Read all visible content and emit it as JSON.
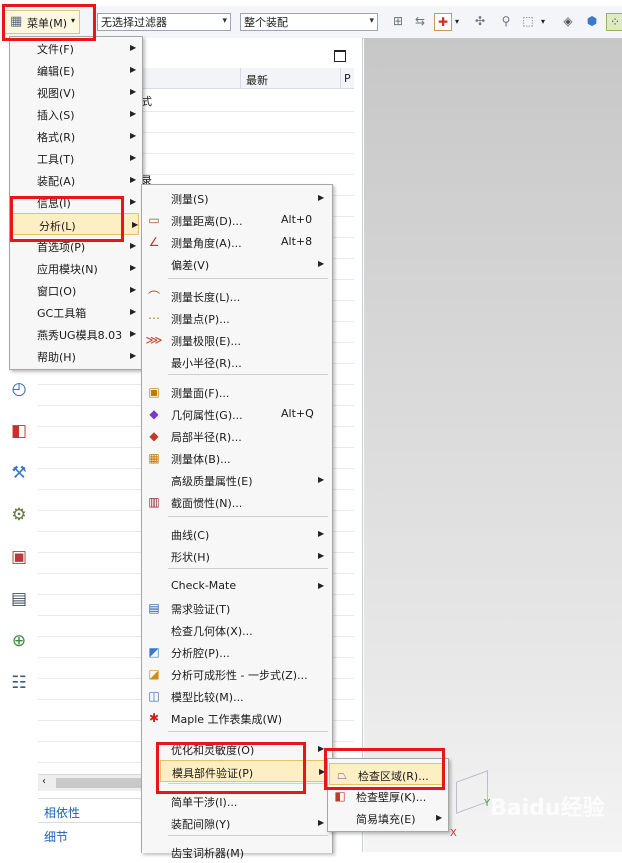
{
  "toolbar": {
    "menu_label": "菜单(M)",
    "filter_value": "无选择过滤器",
    "assembly_value": "整个装配"
  },
  "nav": {
    "col_latest": "最新",
    "col_p": "P",
    "frag1": "式",
    "frag2": "录",
    "footer1": "相依性",
    "footer2": "细节"
  },
  "main_menu": [
    {
      "label": "文件(F)",
      "arrow": true
    },
    {
      "label": "编辑(E)",
      "arrow": true
    },
    {
      "label": "视图(V)",
      "arrow": true
    },
    {
      "label": "插入(S)",
      "arrow": true
    },
    {
      "label": "格式(R)",
      "arrow": true
    },
    {
      "label": "工具(T)",
      "arrow": true
    },
    {
      "label": "装配(A)",
      "arrow": true
    },
    {
      "label": "信息(I)",
      "arrow": true
    },
    {
      "label": "分析(L)",
      "arrow": true
    },
    {
      "label": "首选项(P)",
      "arrow": true
    },
    {
      "label": "应用模块(N)",
      "arrow": true
    },
    {
      "label": "窗口(O)",
      "arrow": true
    },
    {
      "label": "GC工具箱",
      "arrow": true
    },
    {
      "label": "燕秀UG模具8.03",
      "arrow": true
    },
    {
      "label": "帮助(H)",
      "arrow": true
    }
  ],
  "analysis_menu": [
    {
      "label": "测量(S)",
      "arrow": true,
      "icon": "none"
    },
    {
      "label": "测量距离(D)...",
      "shortcut": "Alt+0",
      "icon": "ruler-icon"
    },
    {
      "label": "测量角度(A)...",
      "shortcut": "Alt+8",
      "icon": "angle-icon"
    },
    {
      "label": "偏差(V)",
      "arrow": true,
      "icon": "none"
    },
    {
      "label": "测量长度(L)...",
      "icon": "arc-length-icon"
    },
    {
      "label": "测量点(P)...",
      "icon": "point-icon"
    },
    {
      "label": "测量极限(E)...",
      "icon": "limit-icon"
    },
    {
      "label": "最小半径(R)...",
      "icon": "none"
    },
    {
      "label": "测量面(F)...",
      "icon": "face-icon"
    },
    {
      "label": "几何属性(G)...",
      "shortcut": "Alt+Q",
      "icon": "geometry-icon"
    },
    {
      "label": "局部半径(R)...",
      "icon": "radius-icon"
    },
    {
      "label": "测量体(B)...",
      "icon": "body-icon"
    },
    {
      "label": "高级质量属性(E)",
      "arrow": true,
      "icon": "none"
    },
    {
      "label": "截面惯性(N)...",
      "icon": "inertia-icon"
    },
    {
      "label": "曲线(C)",
      "arrow": true,
      "icon": "none"
    },
    {
      "label": "形状(H)",
      "arrow": true,
      "icon": "none"
    },
    {
      "label": "Check-Mate",
      "arrow": true,
      "icon": "none"
    },
    {
      "label": "需求验证(T)",
      "icon": "requirement-icon"
    },
    {
      "label": "检查几何体(X)...",
      "icon": "none"
    },
    {
      "label": "分析腔(P)...",
      "icon": "cavity-icon"
    },
    {
      "label": "分析可成形性 - 一步式(Z)...",
      "icon": "formability-icon"
    },
    {
      "label": "模型比较(M)...",
      "icon": "compare-icon"
    },
    {
      "label": "Maple 工作表集成(W)",
      "icon": "maple-icon"
    },
    {
      "label": "优化和灵敏度(O)",
      "arrow": true,
      "icon": "none"
    },
    {
      "label": "模具部件验证(P)",
      "arrow": true,
      "icon": "none"
    },
    {
      "label": "简单干涉(I)...",
      "icon": "none"
    },
    {
      "label": "装配间隙(Y)",
      "arrow": true,
      "icon": "none"
    },
    {
      "label": "齿宝词析器(M)",
      "icon": "none"
    }
  ],
  "mold_menu": [
    {
      "label": "检查区域(R)...",
      "icon": "check-region-icon"
    },
    {
      "label": "检查壁厚(K)...",
      "icon": "wall-thickness-icon"
    },
    {
      "label": "简易填充(E)",
      "arrow": true,
      "icon": "none"
    }
  ],
  "colors": {
    "highlight": "#fdeec3",
    "red_box": "#e8161b",
    "link_blue": "#1f5fb4"
  },
  "watermark": "Baidu经验"
}
